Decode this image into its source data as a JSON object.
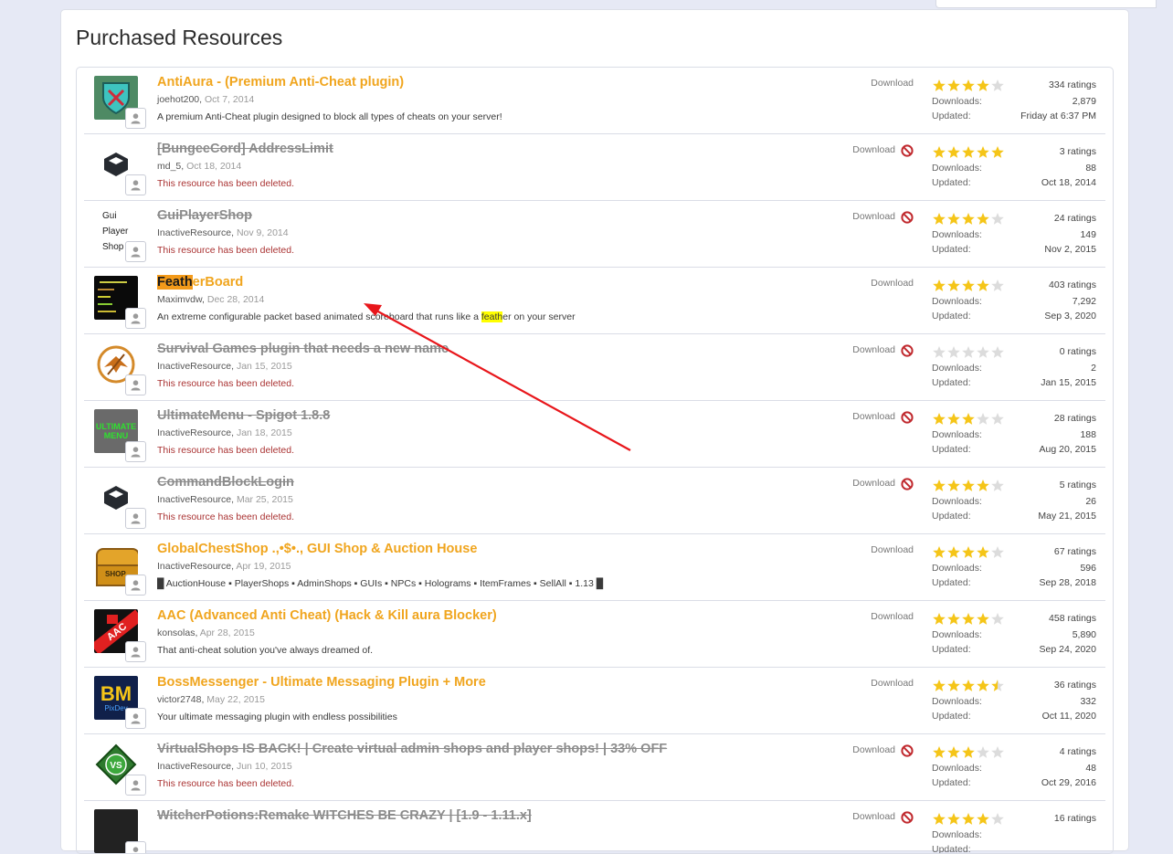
{
  "page_title": "Purchased Resources",
  "labels": {
    "download": "Download",
    "downloads": "Downloads:",
    "updated": "Updated:"
  },
  "colors": {
    "accent": "#f0a51e",
    "star_on": "#f5c518",
    "star_off": "#dcdcdc",
    "deleted_text": "#a33333",
    "arrow": "#e8161b"
  },
  "resources": [
    {
      "icon": "shield-sword-icon",
      "title": "AntiAura - (Premium Anti-Cheat plugin)",
      "deleted": false,
      "author": "joehot200",
      "date": "Oct 7, 2014",
      "desc": "A premium Anti-Cheat plugin designed to block all types of cheats on your server!",
      "rating": 4,
      "ratings": "334 ratings",
      "downloads": "2,879",
      "updated": "Friday at 6:37 PM"
    },
    {
      "icon": "cube-icon",
      "title": "[BungeeCord] AddressLimit",
      "deleted": true,
      "author": "md_5",
      "date": "Oct 18, 2014",
      "desc": "This resource has been deleted.",
      "rating": 5,
      "ratings": "3 ratings",
      "downloads": "88",
      "updated": "Oct 18, 2014"
    },
    {
      "icon": "text-icon",
      "icon_text": [
        "Gui",
        "Player",
        "Shop"
      ],
      "title": "GuiPlayerShop",
      "deleted": true,
      "author": "InactiveResource",
      "date": "Nov 9, 2014",
      "desc": "This resource has been deleted.",
      "rating": 4,
      "ratings": "24 ratings",
      "downloads": "149",
      "updated": "Nov 2, 2015"
    },
    {
      "icon": "scoreboard-icon",
      "title_hl": "Feath",
      "title_rest": "erBoard",
      "deleted": false,
      "author": "Maximvdw",
      "date": "Dec 28, 2014",
      "desc_pre": "An extreme configurable packet based animated scoreboard that runs like a ",
      "desc_hl": "feath",
      "desc_post": "er on your server",
      "rating": 4,
      "ratings": "403 ratings",
      "downloads": "7,292",
      "updated": "Sep 3, 2020"
    },
    {
      "icon": "mockingjay-icon",
      "title": "Survival Games plugin that needs a new name",
      "deleted": true,
      "author": "InactiveResource",
      "date": "Jan 15, 2015",
      "desc": "This resource has been deleted.",
      "rating": 0,
      "ratings": "0 ratings",
      "downloads": "2",
      "updated": "Jan 15, 2015"
    },
    {
      "icon": "ultimate-menu-icon",
      "icon_text": [
        "ULTIMATE",
        "MENU"
      ],
      "title": "UltimateMenu - Spigot 1.8.8",
      "deleted": true,
      "author": "InactiveResource",
      "date": "Jan 18, 2015",
      "desc": "This resource has been deleted.",
      "rating": 3,
      "ratings": "28 ratings",
      "downloads": "188",
      "updated": "Aug 20, 2015"
    },
    {
      "icon": "cube-icon",
      "title": "CommandBlockLogin",
      "deleted": true,
      "author": "InactiveResource",
      "date": "Mar 25, 2015",
      "desc": "This resource has been deleted.",
      "rating": 4,
      "ratings": "5 ratings",
      "downloads": "26",
      "updated": "May 21, 2015"
    },
    {
      "icon": "treasure-chest-icon",
      "icon_text": [
        "SHOP"
      ],
      "title": "GlobalChestShop .,•$•., GUI Shop & Auction House",
      "deleted": false,
      "author": "InactiveResource",
      "date": "Apr 19, 2015",
      "desc": "█ AuctionHouse ▪ PlayerShops ▪ AdminShops ▪ GUIs ▪ NPCs ▪ Holograms ▪ ItemFrames ▪ SellAll ▪ 1.13 █",
      "rating": 4,
      "ratings": "67 ratings",
      "downloads": "596",
      "updated": "Sep 28, 2018"
    },
    {
      "icon": "aac-icon",
      "icon_text": [
        "AAC"
      ],
      "title": "AAC (Advanced Anti Cheat) (Hack & Kill aura Blocker)",
      "deleted": false,
      "author": "konsolas",
      "date": "Apr 28, 2015",
      "desc": "That anti-cheat solution you've always dreamed of.",
      "rating": 4,
      "ratings": "458 ratings",
      "downloads": "5,890",
      "updated": "Sep 24, 2020"
    },
    {
      "icon": "bm-pixdev-icon",
      "icon_text": [
        "BM",
        "PixDev"
      ],
      "title": "BossMessenger - Ultimate Messaging Plugin + More",
      "deleted": false,
      "author": "victor2748",
      "date": "May 22, 2015",
      "desc": "Your ultimate messaging plugin with endless possibilities",
      "rating": 4.5,
      "ratings": "36 ratings",
      "downloads": "332",
      "updated": "Oct 11, 2020"
    },
    {
      "icon": "vs-shield-icon",
      "icon_text": [
        "VS"
      ],
      "title": "VirtualShops IS BACK! | Create virtual admin shops and player shops! | 33% OFF",
      "deleted": true,
      "author": "InactiveResource",
      "date": "Jun 10, 2015",
      "desc": "This resource has been deleted.",
      "rating": 3,
      "ratings": "4 ratings",
      "downloads": "48",
      "updated": "Oct 29, 2016"
    },
    {
      "icon": "potion-icon",
      "title": "WitcherPotions:Remake WITCHES BE CRAZY | [1.9 - 1.11.x]",
      "deleted": true,
      "author": "",
      "date": "",
      "desc": "",
      "rating": 4,
      "ratings": "16 ratings",
      "downloads": "",
      "updated": ""
    }
  ]
}
